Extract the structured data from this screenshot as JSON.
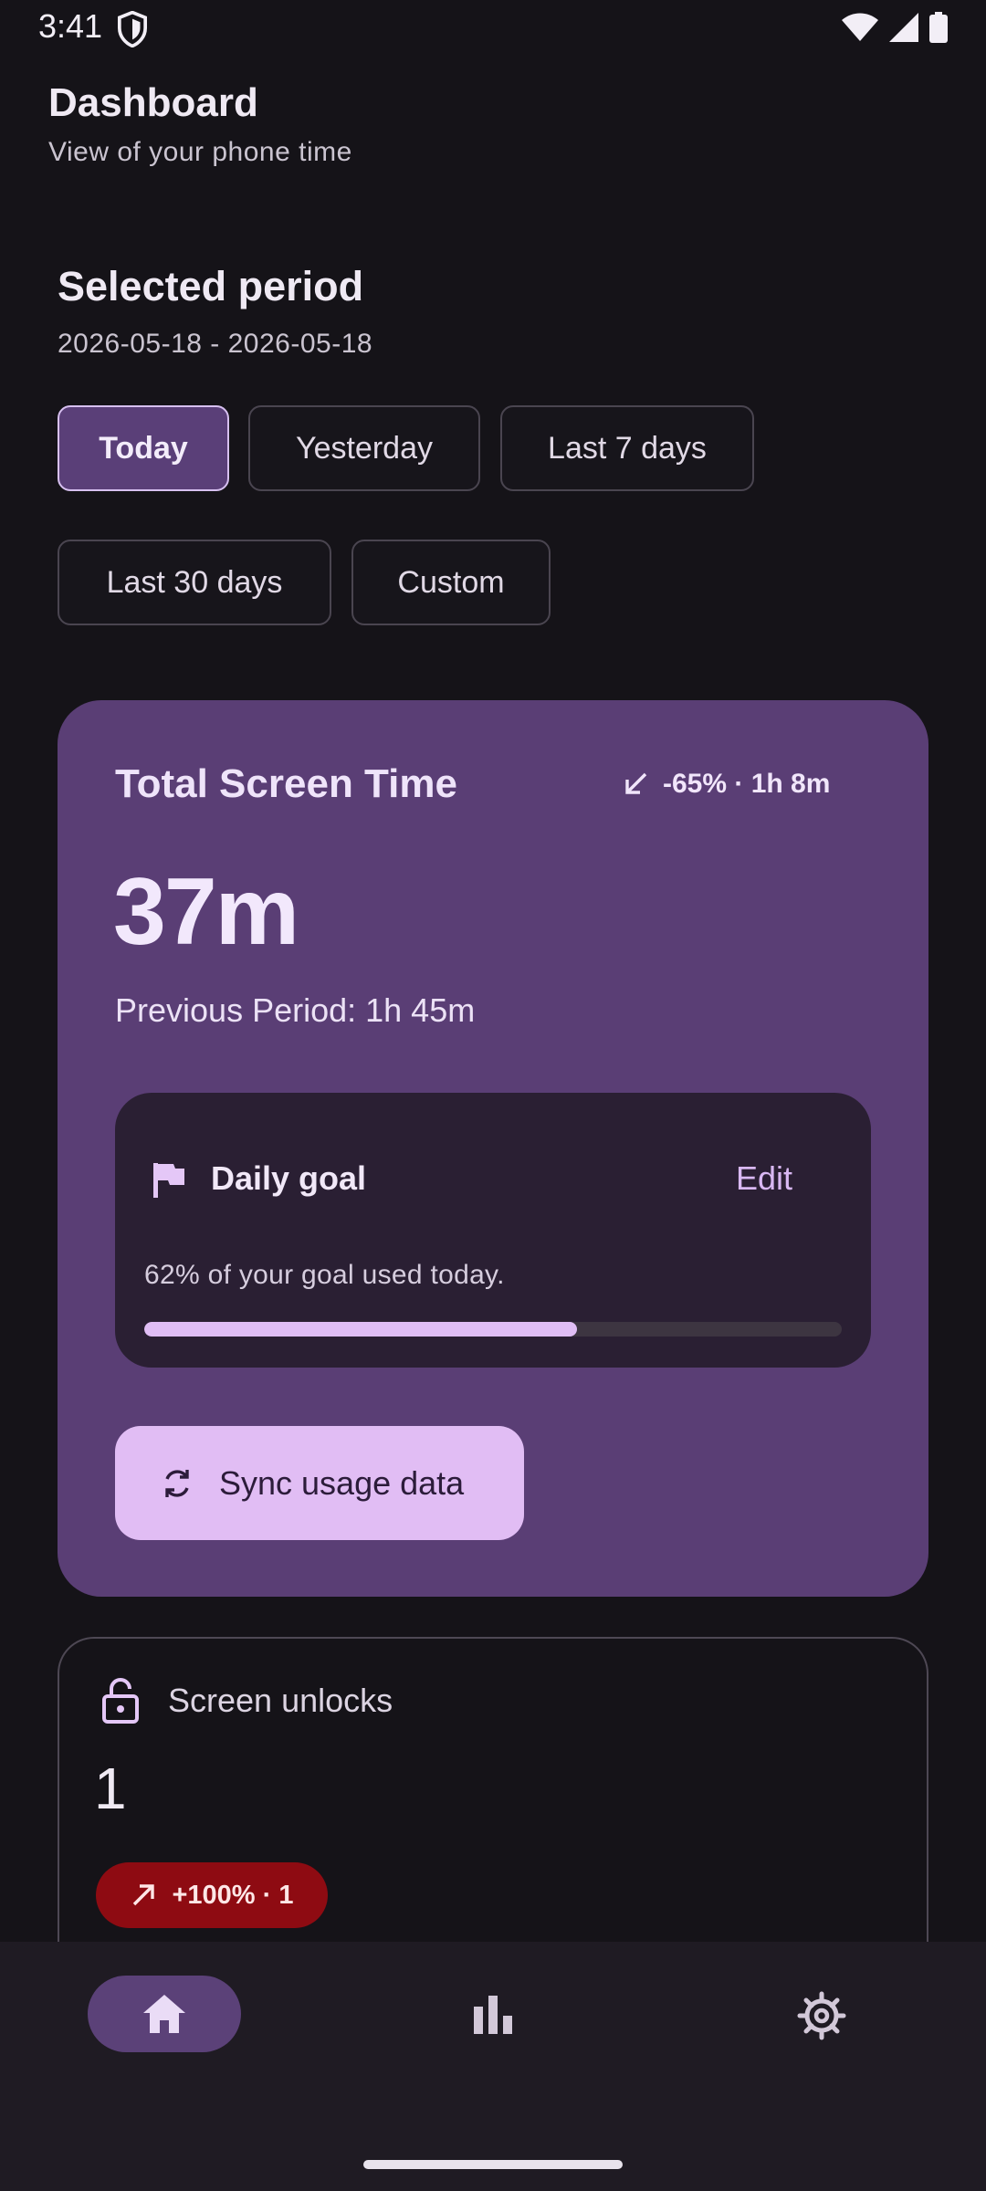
{
  "status_bar": {
    "time": "3:41"
  },
  "header": {
    "title": "Dashboard",
    "subtitle": "View of your phone time"
  },
  "period": {
    "title": "Selected period",
    "range": "2026-05-18 - 2026-05-18",
    "chips": [
      {
        "label": "Today",
        "selected": true
      },
      {
        "label": "Yesterday",
        "selected": false
      },
      {
        "label": "Last 7 days",
        "selected": false
      },
      {
        "label": "Last 30 days",
        "selected": false
      },
      {
        "label": "Custom",
        "selected": false
      }
    ]
  },
  "screen_time": {
    "title": "Total Screen Time",
    "delta": "-65% · 1h 8m",
    "value": "37m",
    "previous": "Previous Period: 1h 45m"
  },
  "goal": {
    "title": "Daily goal",
    "edit_label": "Edit",
    "text": "62% of your goal used today.",
    "progress": 0.62
  },
  "sync": {
    "label": "Sync usage data"
  },
  "unlocks": {
    "label": "Screen unlocks",
    "value": "1",
    "delta": "+100% · 1"
  },
  "colors": {
    "background": "#151318",
    "card": "#5a3e75",
    "accent": "#e1bdf4",
    "negative_badge": "#8e0b12"
  },
  "nav": {
    "items": [
      "home-icon",
      "bar-chart-icon",
      "settings-icon"
    ],
    "selected": "home-icon"
  }
}
